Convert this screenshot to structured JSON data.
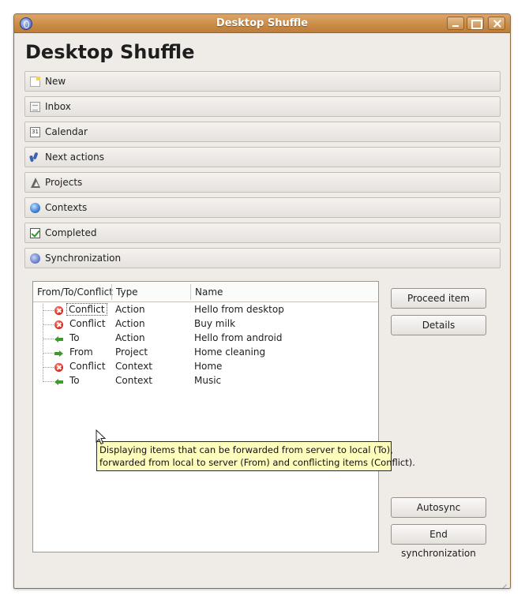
{
  "window": {
    "title": "Desktop Shuffle"
  },
  "header": {
    "title": "Desktop Shuffle"
  },
  "nav": {
    "items": [
      {
        "label": "New",
        "icon": "new-note-icon"
      },
      {
        "label": "Inbox",
        "icon": "inbox-icon"
      },
      {
        "label": "Calendar",
        "icon": "calendar-icon",
        "icon_text": "31"
      },
      {
        "label": "Next actions",
        "icon": "footprints-icon"
      },
      {
        "label": "Projects",
        "icon": "projects-icon"
      },
      {
        "label": "Contexts",
        "icon": "globe-icon"
      },
      {
        "label": "Completed",
        "icon": "checkbox-icon"
      },
      {
        "label": "Synchronization",
        "icon": "sync-icon"
      }
    ]
  },
  "table": {
    "columns": [
      "From/To/Conflict",
      "Type",
      "Name"
    ],
    "rows": [
      {
        "status": "Conflict",
        "type": "Action",
        "name": "Hello from desktop",
        "icon": "conflict-icon"
      },
      {
        "status": "Conflict",
        "type": "Action",
        "name": "Buy milk",
        "icon": "conflict-icon"
      },
      {
        "status": "To",
        "type": "Action",
        "name": "Hello from android",
        "icon": "arrow-left-icon"
      },
      {
        "status": "From",
        "type": "Project",
        "name": "Home cleaning",
        "icon": "arrow-right-icon"
      },
      {
        "status": "Conflict",
        "type": "Context",
        "name": "Home",
        "icon": "conflict-icon"
      },
      {
        "status": "To",
        "type": "Context",
        "name": "Music",
        "icon": "arrow-left-icon"
      }
    ]
  },
  "buttons": {
    "proceed": "Proceed item",
    "details": "Details",
    "autosync": "Autosync",
    "end_sync": "End synchronization"
  },
  "tooltip": {
    "line1": "Displaying items that can be forwarded from server to local (To),",
    "line2": "forwarded from local to server (From) and conflicting items (Conflict)."
  },
  "colors": {
    "titlebar": "#c98b44",
    "window_bg": "#efebe7",
    "tooltip_bg": "#fcfcbd",
    "conflict": "#d0221a",
    "arrow": "#3f9a2c"
  }
}
